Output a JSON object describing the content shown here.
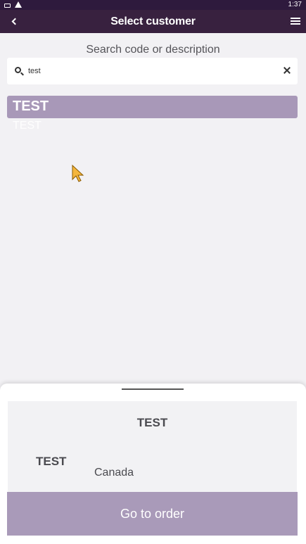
{
  "status_bar": {
    "time": "1:37"
  },
  "app_bar": {
    "title": "Select customer"
  },
  "search": {
    "label": "Search code or description",
    "value": "test"
  },
  "results": [
    {
      "code": "TEST",
      "description": "TEST"
    }
  ],
  "sheet": {
    "title": "TEST",
    "customer_code": "TEST",
    "country": "Canada",
    "button_label": "Go to order"
  },
  "colors": {
    "status_bar": "#2e1a3d",
    "app_bar": "#38213f",
    "accent": "#a898b8",
    "background": "#f2f1f4"
  }
}
